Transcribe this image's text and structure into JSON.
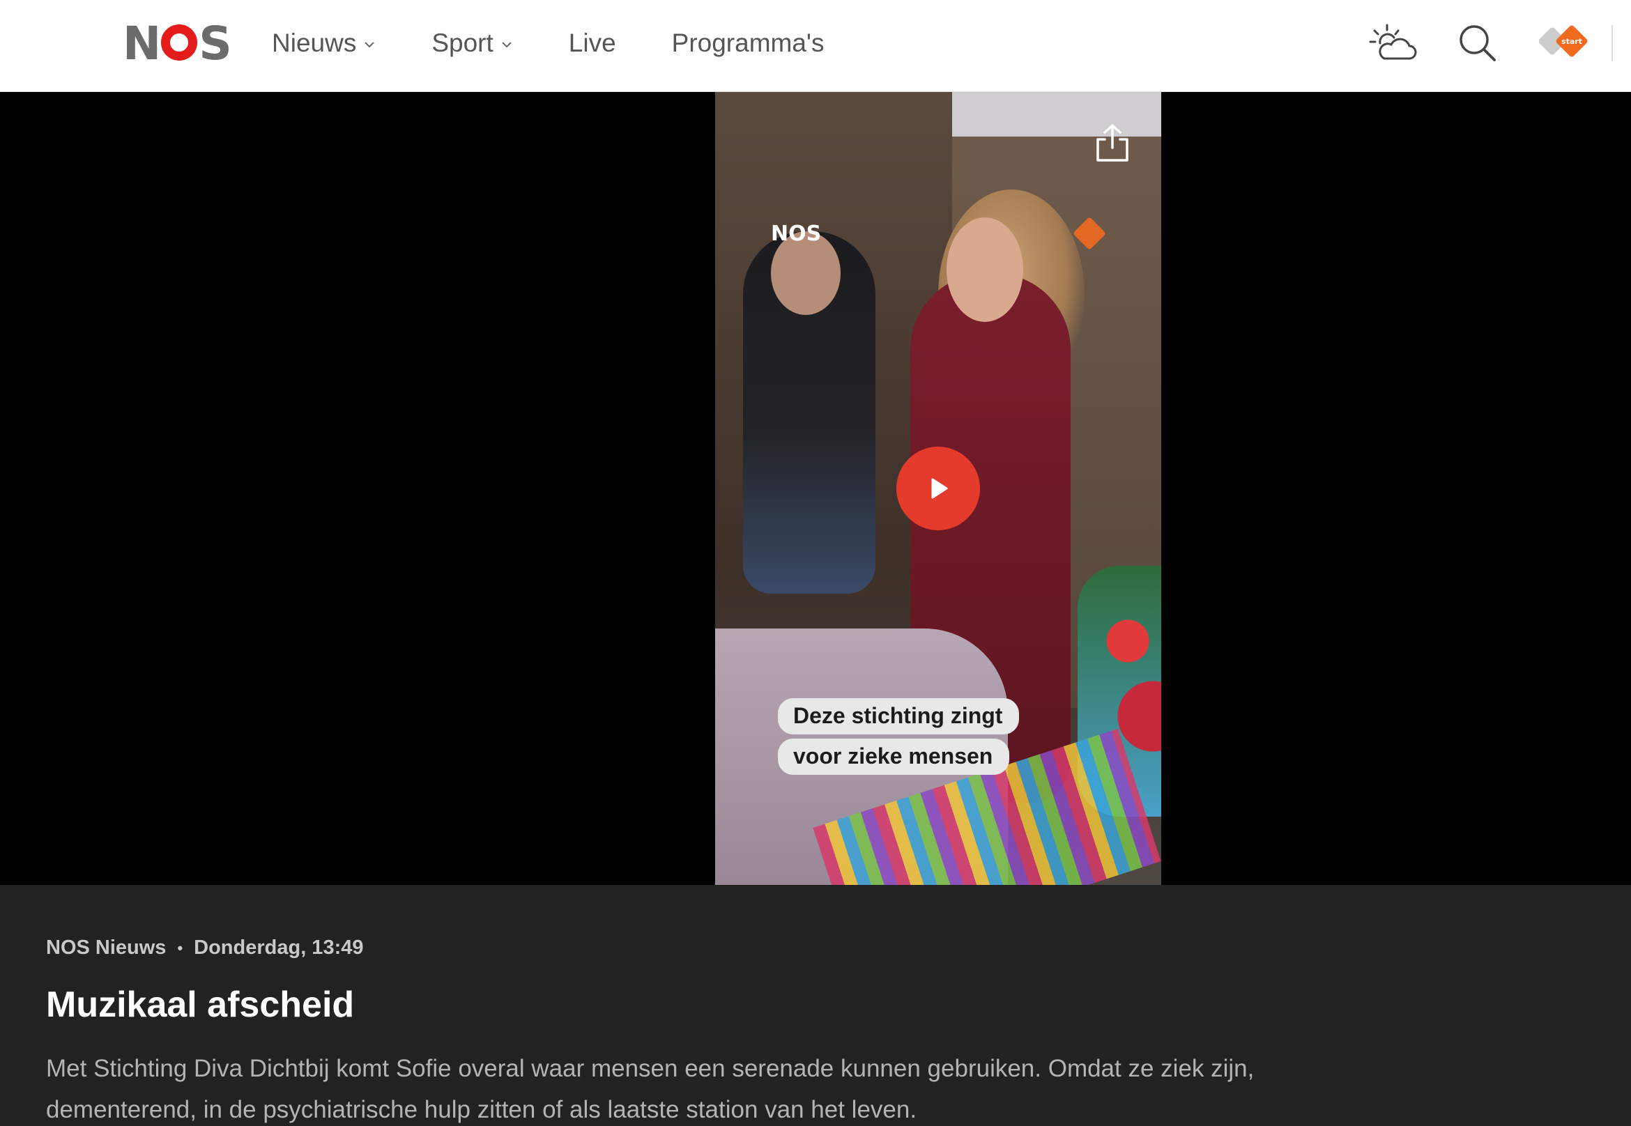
{
  "header": {
    "logo_text": "NOS",
    "nav": [
      {
        "label": "Nieuws",
        "has_dropdown": true
      },
      {
        "label": "Sport",
        "has_dropdown": true
      },
      {
        "label": "Live",
        "has_dropdown": false
      },
      {
        "label": "Programma's",
        "has_dropdown": false
      }
    ],
    "icons": [
      "weather-icon",
      "search-icon",
      "npo-start-icon"
    ],
    "npo_start_label": "start"
  },
  "video": {
    "watermark": "NOS",
    "caption_lines": [
      "Deze stichting zingt",
      "voor zieke mensen"
    ],
    "play_color": "#e43b2d"
  },
  "article": {
    "source": "NOS Nieuws",
    "separator": "•",
    "timestamp": "Donderdag, 13:49",
    "title": "Muzikaal afscheid",
    "description": "Met Stichting Diva Dichtbij komt Sofie overal waar mensen een serenade kunnen gebruiken. Omdat ze ziek zijn, dementerend, in de psychiatrische hulp zitten of als laatste station van het leven."
  },
  "colors": {
    "brand_red": "#e41c1c",
    "npo_orange": "#ef6a1f",
    "background_dark": "#222222"
  }
}
